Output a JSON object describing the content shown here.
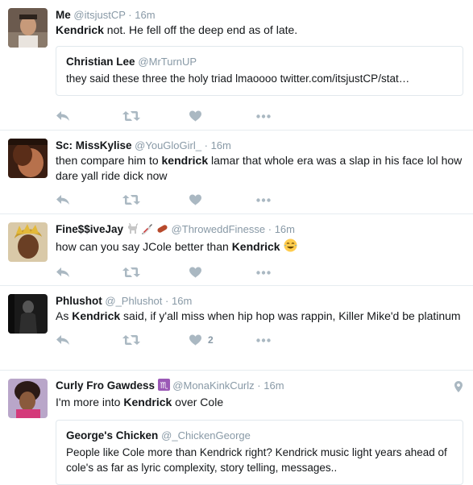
{
  "tweets": [
    {
      "name": "Me",
      "handle": "@itsjustCP",
      "time": "16m",
      "text_pre": "",
      "text_bold": "Kendrick",
      "text_post": " not. He fell off the deep end as of late.",
      "quote": {
        "name": "Christian Lee",
        "handle": "@MrTurnUP",
        "text": "they said these three the holy triad lmaoooo twitter.com/itsjustCP/stat…"
      },
      "like_count": ""
    },
    {
      "name": "Sc: MissKylise",
      "handle": "@YouGloGirl_",
      "time": "16m",
      "text_pre": "then compare him to ",
      "text_bold": "kendrick",
      "text_post": " lamar that whole era was a slap in his face lol how dare yall ride dick now",
      "like_count": ""
    },
    {
      "name": "Fine$$iveJay",
      "handle": "@ThroweddFinesse",
      "time": "16m",
      "text_pre": "how can you say JCole better than ",
      "text_bold": "Kendrick",
      "text_post": " ",
      "like_count": ""
    },
    {
      "name": "Phlushot",
      "handle": "@_Phlushot",
      "time": "16m",
      "text_pre": "As ",
      "text_bold": "Kendrick",
      "text_post": " said, if y'all miss when hip hop was rappin, Killer Mike'd be platinum",
      "like_count": "2"
    },
    {
      "name": "Curly Fro Gawdess",
      "handle": "@MonaKinkCurlz",
      "time": "16m",
      "text_pre": "I'm more into ",
      "text_bold": "Kendrick",
      "text_post": " over Cole",
      "quote": {
        "name": "George's Chicken",
        "handle": "@_ChickenGeorge",
        "text": "People like Cole more than Kendrick right? Kendrick music light years ahead of cole's as far as lyric complexity, story telling, messages.."
      },
      "like_count": ""
    }
  ],
  "separator": "·",
  "colors": {
    "text": "#14171a",
    "muted": "#8899a6",
    "icon": "#aab8c2",
    "border": "#e6ecf0"
  }
}
